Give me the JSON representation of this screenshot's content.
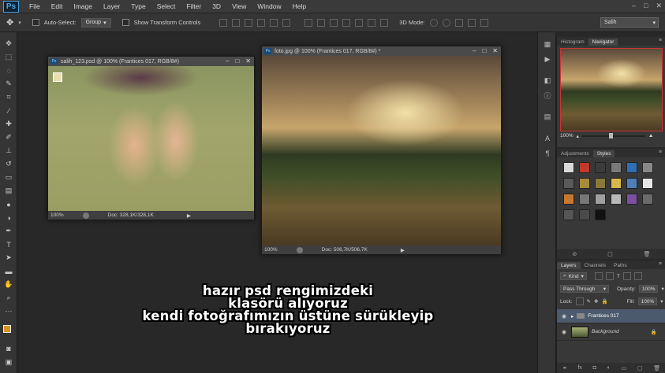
{
  "menubar": {
    "logo": "Ps",
    "items": [
      "File",
      "Edit",
      "Image",
      "Layer",
      "Type",
      "Select",
      "Filter",
      "3D",
      "View",
      "Window",
      "Help"
    ],
    "window_controls": [
      "–",
      "□",
      "✕"
    ]
  },
  "options_bar": {
    "auto_select_label": "Auto-Select:",
    "auto_select_value": "Group",
    "show_transform_label": "Show Transform Controls",
    "mode_3d_label": "3D Mode:",
    "workspace": "Salih"
  },
  "doc1": {
    "title": "salih_123.psd @ 100% (Frantices 017, RGB/8#)",
    "zoom": "100%",
    "doc_size": "Doc: 328,1K/328,1K"
  },
  "doc2": {
    "title": "foto.jpg @ 100% (Frantices 017, RGB/8#) *",
    "zoom": "100%",
    "doc_size": "Doc: 506,7K/506,7K"
  },
  "navigator": {
    "tabs": [
      "Histogram",
      "Navigator"
    ],
    "zoom": "100%"
  },
  "styles_panel": {
    "tabs": [
      "Adjustments",
      "Styles"
    ],
    "swatches": [
      "#d9d9d9",
      "#c0392b",
      "#3b3b3b",
      "#7a7a7a",
      "#2f6fb5",
      "#888888",
      "#5a5a5a",
      "#a88a3a",
      "#8a7a3a",
      "#d8b64a",
      "#4e7fb8",
      "#e6e6e6",
      "#c7782e",
      "#777777",
      "#a0a0a0",
      "#b8b8b8",
      "#7b4fa1",
      "#6a6a6a",
      "#555555",
      "#4a4a4a",
      "#111111"
    ]
  },
  "layers_panel": {
    "tabs": [
      "Layers",
      "Channels",
      "Paths"
    ],
    "kind_label": "Kind",
    "blend_mode": "Pass Through",
    "opacity_label": "Opacity:",
    "opacity_value": "100%",
    "lock_label": "Lock:",
    "fill_label": "Fill:",
    "fill_value": "100%",
    "layers": [
      {
        "name": "Frantices 017"
      },
      {
        "name": "Background"
      }
    ]
  },
  "subtitle": {
    "line1": "hazır psd rengimizdeki",
    "line2": "klasörü alıyoruz",
    "line3": "kendi fotoğrafımızın üstüne sürükleyip",
    "line4": "bırakıyoruz"
  },
  "colors": {
    "foreground": "#d9941f",
    "background": "#111111",
    "layer_selected": "#4c5a6e"
  }
}
